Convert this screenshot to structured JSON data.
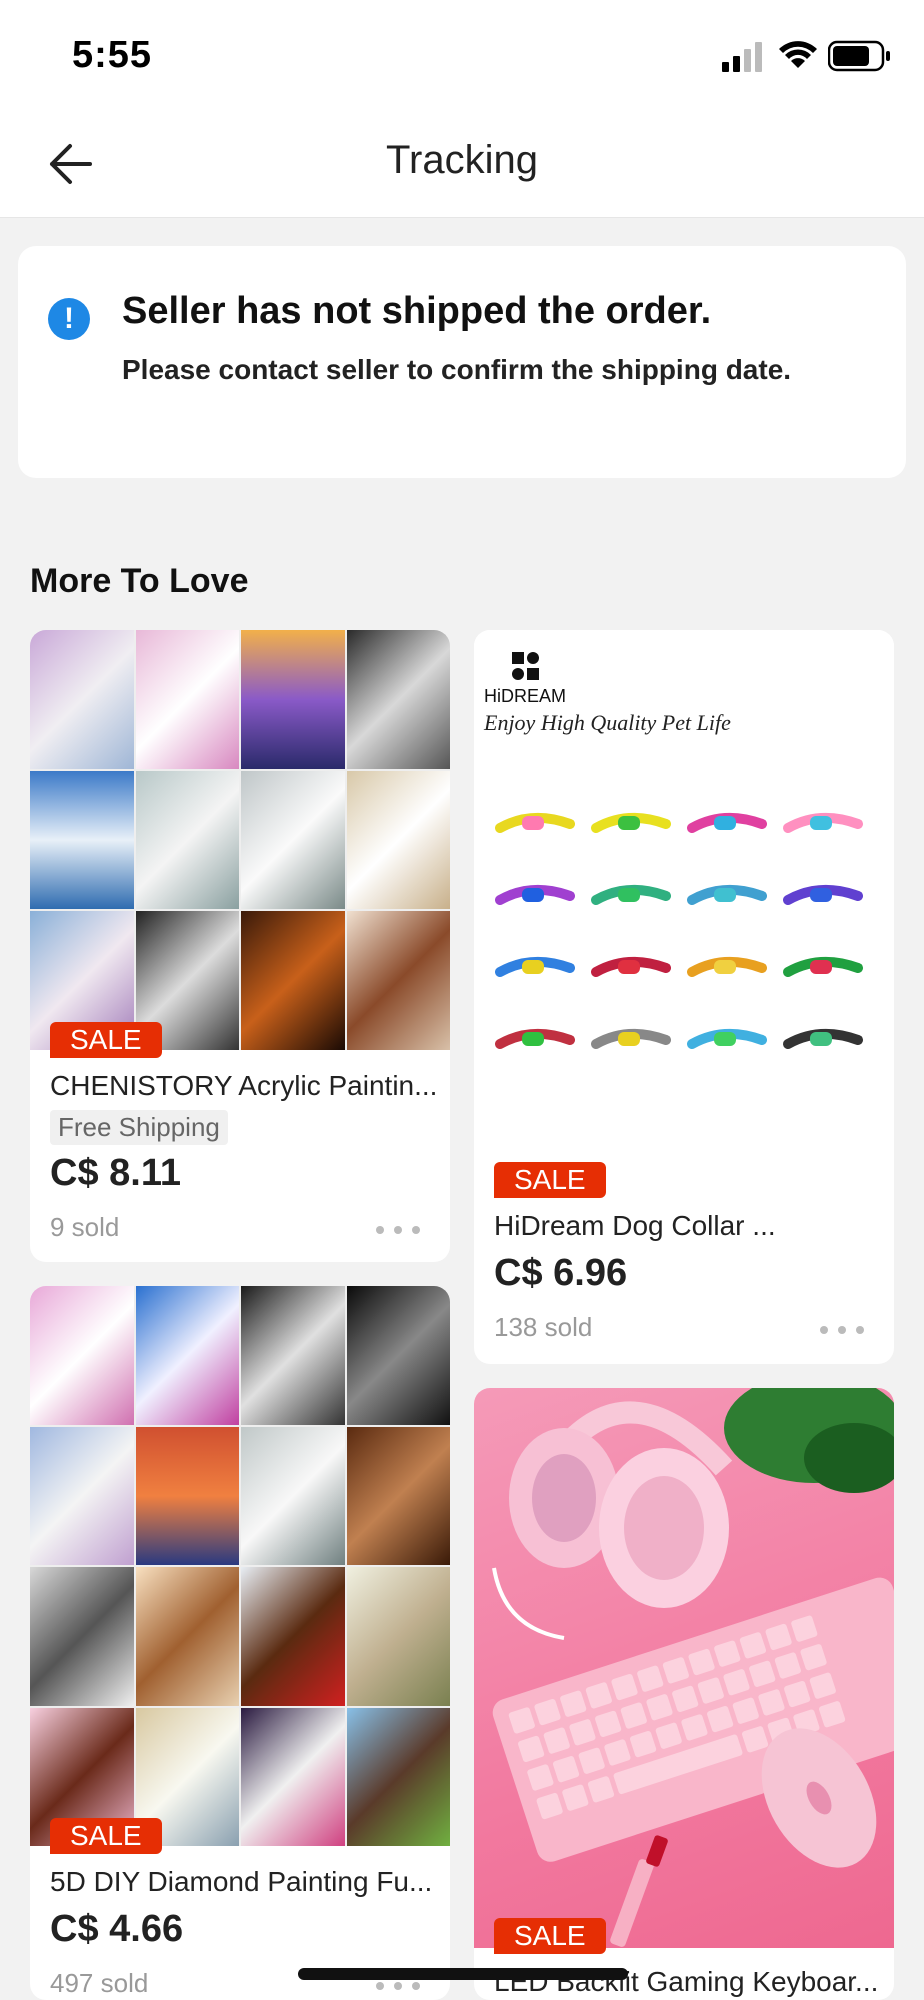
{
  "status": {
    "time": "5:55"
  },
  "nav": {
    "title": "Tracking"
  },
  "notice": {
    "title": "Seller has not shipped the order.",
    "text": "Please contact seller to confirm the shipping date."
  },
  "section": {
    "title": "More To Love"
  },
  "products": [
    {
      "sale": "SALE",
      "title": "CHENISTORY Acrylic Paintin...",
      "shipping": "Free Shipping",
      "price": "C$ 8.11",
      "sold": "9 sold"
    },
    {
      "sale": "SALE",
      "title": "HiDream Dog Collar ...",
      "price": "C$ 6.96",
      "sold": "138 sold",
      "brand": "HiDREAM",
      "tagline": "Enjoy High Quality Pet Life"
    },
    {
      "sale": "SALE",
      "title": "5D DIY Diamond Painting Fu...",
      "price": "C$ 4.66",
      "sold": "497 sold"
    },
    {
      "sale": "SALE",
      "title": "LED Backlit Gaming Keyboar..."
    }
  ]
}
